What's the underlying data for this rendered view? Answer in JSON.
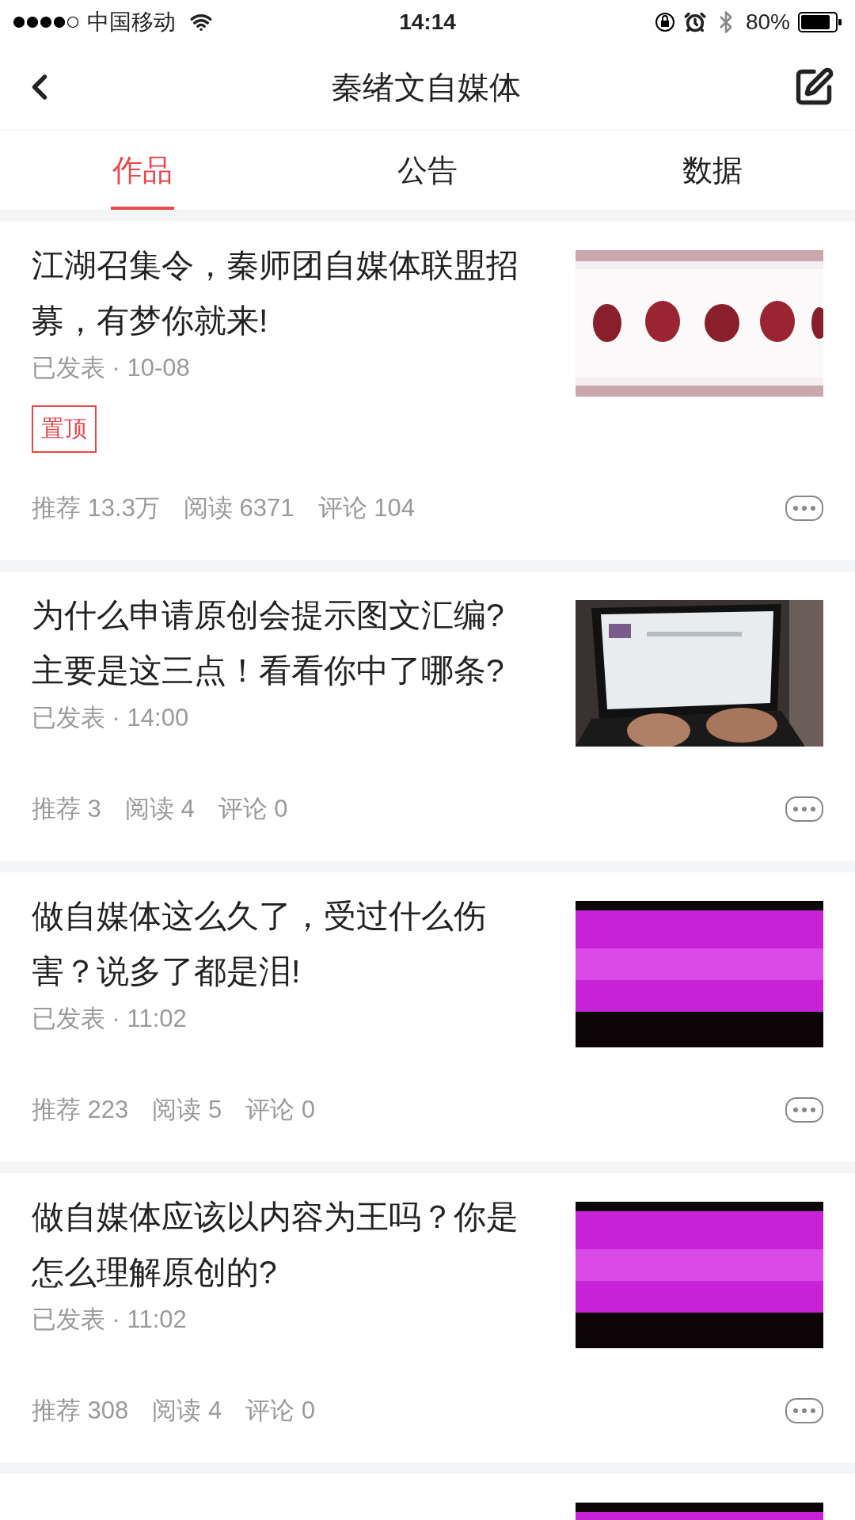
{
  "status_bar": {
    "carrier": "中国移动",
    "time": "14:14",
    "battery": "80%"
  },
  "nav": {
    "title": "秦绪文自媒体"
  },
  "tabs": [
    {
      "label": "作品",
      "selected": true
    },
    {
      "label": "公告",
      "selected": false
    },
    {
      "label": "数据",
      "selected": false
    }
  ],
  "articles": [
    {
      "title": "江湖召集令，秦师团自媒体联盟招募，有梦你就来!",
      "meta": "已发表 · 10-08",
      "tag": "置顶",
      "stats": [
        "推荐 13.3万",
        "阅读 6371",
        "评论 104"
      ],
      "kind": "picture"
    },
    {
      "title": "为什么申请原创会提示图文汇编?主要是这三点！看看你中了哪条?",
      "meta": "已发表 · 14:00",
      "stats": [
        "推荐 3",
        "阅读 4",
        "评论 0"
      ],
      "kind": "picture"
    },
    {
      "title": "做自媒体这么久了，受过什么伤害？说多了都是泪!",
      "meta": "已发表 · 11:02",
      "stats": [
        "推荐 223",
        "阅读 5",
        "评论 0"
      ],
      "kind": "picture"
    },
    {
      "title": "做自媒体应该以内容为王吗？你是怎么理解原创的?",
      "meta": "已发表 · 11:02",
      "stats": [
        "推荐 308",
        "阅读 4",
        "评论 0"
      ],
      "kind": "picture"
    },
    {
      "kind": "picture"
    }
  ]
}
